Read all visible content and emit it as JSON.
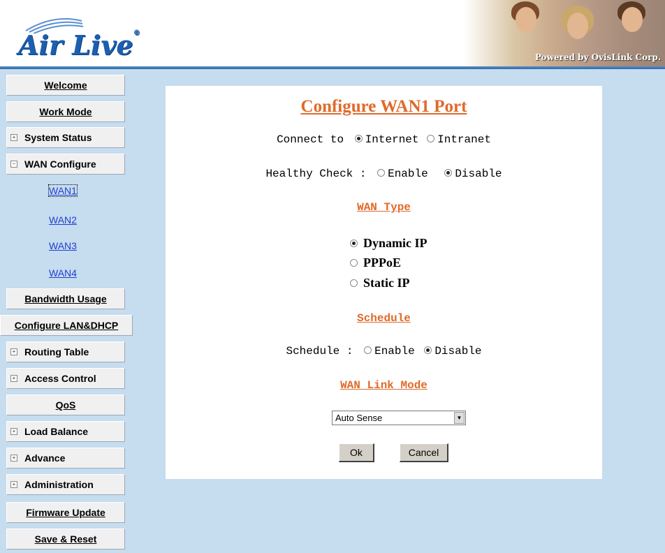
{
  "header": {
    "logo_text": "Air Live",
    "logo_reg": "®",
    "powered_by": "Powered by OvisLink Corp."
  },
  "sidebar": {
    "items": [
      {
        "label": "Welcome"
      },
      {
        "label": "Work Mode"
      },
      {
        "label": "System Status",
        "expander": "+"
      },
      {
        "label": "WAN Configure",
        "expander": "−"
      },
      {
        "label": "Bandwidth Usage"
      },
      {
        "label": "Configure LAN&DHCP"
      },
      {
        "label": "Routing Table",
        "expander": "+"
      },
      {
        "label": "Access Control",
        "expander": "+"
      },
      {
        "label": "QoS"
      },
      {
        "label": "Load Balance",
        "expander": "+"
      },
      {
        "label": "Advance",
        "expander": "+"
      },
      {
        "label": "Administration",
        "expander": "+"
      },
      {
        "label": "Firmware Update"
      },
      {
        "label": "Save & Reset"
      }
    ],
    "wan_links": [
      "WAN1",
      "WAN2",
      "WAN3",
      "WAN4"
    ],
    "active_wan": "WAN1"
  },
  "main": {
    "title": "Configure WAN1 Port",
    "connect_to": {
      "label": "Connect to",
      "options": [
        "Internet",
        "Intranet"
      ],
      "selected": "Internet"
    },
    "healthy_check": {
      "label": "Healthy Check :",
      "options": [
        "Enable",
        "Disable"
      ],
      "selected": "Disable"
    },
    "wan_type": {
      "title": "WAN Type",
      "options": [
        "Dynamic IP",
        "PPPoE",
        "Static IP"
      ],
      "selected": "Dynamic IP"
    },
    "schedule": {
      "title": "Schedule",
      "label": "Schedule :",
      "options": [
        "Enable",
        "Disable"
      ],
      "selected": "Disable"
    },
    "wan_link_mode": {
      "title": "WAN Link Mode",
      "value": "Auto Sense"
    },
    "buttons": {
      "ok": "Ok",
      "cancel": "Cancel"
    }
  },
  "colors": {
    "background": "#c6dcef",
    "accent_title": "#e06a2a",
    "link": "#1f3fcf",
    "logo_blue": "#1c5fb0"
  }
}
